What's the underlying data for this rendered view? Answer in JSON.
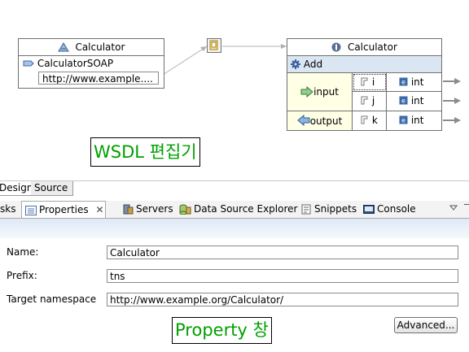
{
  "service_box": {
    "title": "Calculator",
    "port_name": "CalculatorSOAP",
    "address": "http://www.example...."
  },
  "porttype_box": {
    "title": "Calculator",
    "operation": "Add",
    "input_label": "input",
    "output_label": "output",
    "parts": [
      {
        "name": "i",
        "type": "int"
      },
      {
        "name": "j",
        "type": "int"
      },
      {
        "name": "k",
        "type": "int"
      }
    ]
  },
  "annotations": {
    "editor": "WSDL 편집기",
    "property": "Property 창"
  },
  "editor_tabs": [
    "Design",
    "Source"
  ],
  "view_tabs": {
    "tasks": "sks",
    "properties": "Properties",
    "servers": "Servers",
    "datasource": "Data Source Explorer",
    "snippets": "Snippets",
    "console": "Console"
  },
  "properties": {
    "name_label": "Name:",
    "name_value": "Calculator",
    "prefix_label": "Prefix:",
    "prefix_value": "tns",
    "ns_label": "Target namespace",
    "ns_value": "http://www.example.org/Calculator/",
    "advanced_button": "Advanced..."
  }
}
